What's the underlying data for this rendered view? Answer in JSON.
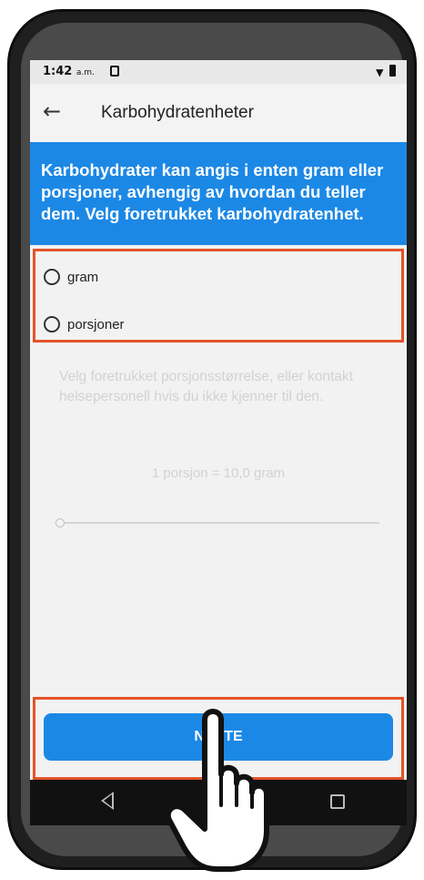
{
  "status_bar": {
    "time": "1:42",
    "ampm": "a.m."
  },
  "app_bar": {
    "title": "Karbohydratenheter"
  },
  "banner": {
    "text": "Karbohydrater kan angis i enten gram eller porsjoner, avhengig av hvordan du teller dem. Velg foretrukket karbohydratenhet."
  },
  "options": [
    {
      "label": "gram",
      "selected": false
    },
    {
      "label": "porsjoner",
      "selected": false
    }
  ],
  "portion_info": {
    "hint": "Velg foretrukket porsjonsstørrelse, eller kontakt helsepersonell hvis du ikke kjenner til den.",
    "value_text": "1 porsjon = 10,0 gram",
    "slider_fraction": 0.0
  },
  "buttons": {
    "next_label": "NESTE"
  },
  "colors": {
    "accent": "#1c88e6",
    "highlight_border": "#e4532a"
  },
  "icons": [
    "back-arrow-icon",
    "sim-card-icon",
    "wifi-icon",
    "battery-icon",
    "nav-back-icon",
    "nav-home-icon",
    "nav-recent-icon",
    "pointing-hand-icon"
  ]
}
